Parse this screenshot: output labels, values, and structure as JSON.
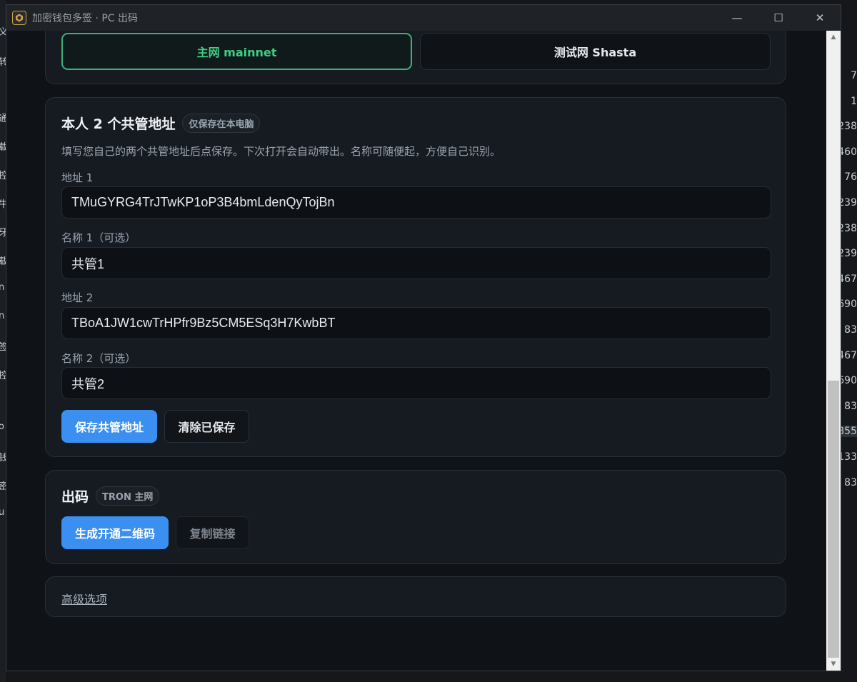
{
  "window": {
    "title": "加密钱包多签 · PC 出码",
    "controls": {
      "minimize": "—",
      "maximize": "☐",
      "close": "✕"
    }
  },
  "background": {
    "left_glyphs": [
      "义",
      "转",
      "通",
      "载",
      "控",
      "牛",
      "牙",
      "载",
      "n",
      "n",
      "签",
      "控",
      "o",
      "钱",
      "密",
      "u"
    ],
    "right_numbers": [
      "7",
      "1",
      "238",
      "460",
      "76",
      "239",
      "238",
      "239",
      "467",
      "690",
      "83",
      "467",
      "690",
      "83",
      "855",
      "133",
      "83"
    ]
  },
  "network": {
    "mainnet_label": "主网 mainnet",
    "testnet_label": "测试网 Shasta",
    "selected": "mainnet"
  },
  "cosign": {
    "title": "本人 2 个共管地址",
    "badge": "仅保存在本电脑",
    "description": "填写您自己的两个共管地址后点保存。下次打开会自动带出。名称可随便起，方便自己识别。",
    "address1_label": "地址 1",
    "address1_value": "TMuGYRG4TrJTwKP1oP3B4bmLdenQyTojBn",
    "name1_label": "名称 1（可选）",
    "name1_value": "共管1",
    "address2_label": "地址 2",
    "address2_value": "TBoA1JW1cwTrHPfr9Bz5CM5ESq3H7KwbBT",
    "name2_label": "名称 2（可选）",
    "name2_value": "共管2",
    "save_label": "保存共管地址",
    "clear_label": "清除已保存"
  },
  "output": {
    "title": "出码",
    "badge": "TRON 主网",
    "generate_label": "生成开通二维码",
    "copy_label": "复制链接"
  },
  "advanced": {
    "label": "高级选项"
  },
  "colors": {
    "accent_blue": "#3b8ff0",
    "accent_green": "#3ecf86",
    "card_bg": "#161b22",
    "page_bg": "#0f1216"
  }
}
